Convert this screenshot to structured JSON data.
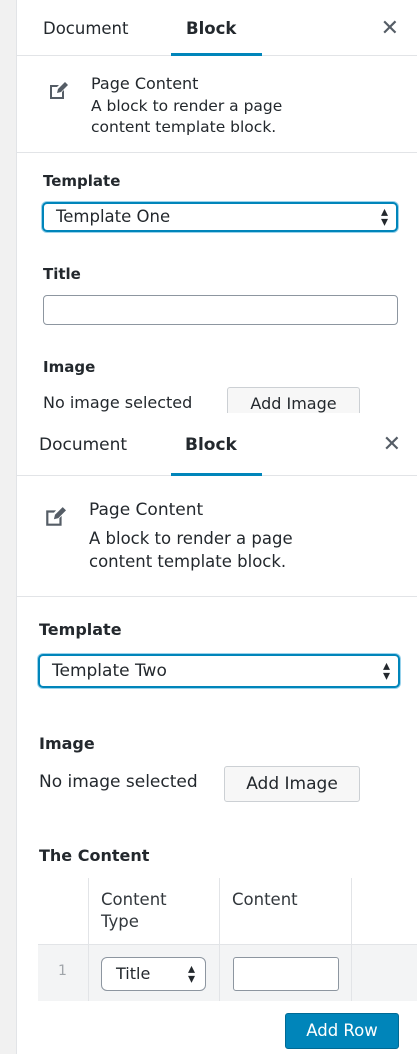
{
  "panel1": {
    "tabs": [
      {
        "label": "Document"
      },
      {
        "label": "Block"
      }
    ],
    "close_icon": "✕",
    "block": {
      "icon": "edit-icon",
      "name": "Page Content",
      "description_line1": "A block to render a page",
      "description_line2": "content template block."
    },
    "template": {
      "label": "Template",
      "selected": "Template One"
    },
    "title_field": {
      "label": "Title",
      "value": ""
    },
    "image": {
      "label": "Image",
      "status": "No image selected",
      "button": "Add Image"
    }
  },
  "panel2": {
    "tabs": [
      {
        "label": "Document"
      },
      {
        "label": "Block"
      }
    ],
    "close_icon": "✕",
    "block": {
      "icon": "edit-icon",
      "name": "Page Content",
      "description_line1": "A block to render a page",
      "description_line2": "content template block."
    },
    "template": {
      "label": "Template",
      "selected": "Template Two"
    },
    "image": {
      "label": "Image",
      "status": "No image selected",
      "button": "Add Image"
    },
    "content": {
      "label": "The Content",
      "columns": [
        {
          "line1": "Content",
          "line2": "Type"
        },
        {
          "line1": "Content",
          "line2": ""
        }
      ],
      "rows": [
        {
          "index": "1",
          "type": "Title",
          "content": ""
        }
      ],
      "add_row": "Add Row"
    }
  },
  "colors": {
    "accent": "#0085ba",
    "border": "#e2e4e7",
    "text": "#23282d"
  }
}
